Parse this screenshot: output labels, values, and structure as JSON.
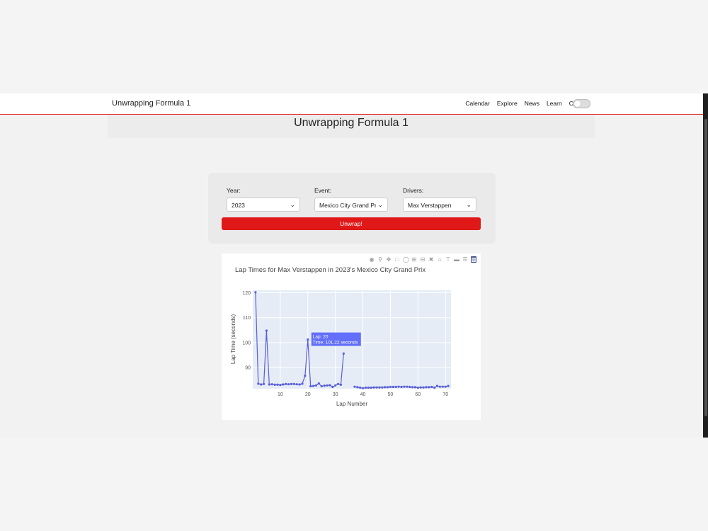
{
  "nav": {
    "brand": "Unwrapping Formula 1",
    "links": [
      "Calendar",
      "Explore",
      "News",
      "Learn",
      "Contact"
    ]
  },
  "page_title": "Unwrapping Formula 1",
  "form": {
    "year": {
      "label": "Year:",
      "value": "2023"
    },
    "event": {
      "label": "Event:",
      "value": "Mexico City Grand Prix"
    },
    "drivers": {
      "label": "Drivers:",
      "value": "Max Verstappen"
    },
    "button_label": "Unwrap!"
  },
  "modebar_icons": [
    "camera-icon",
    "zoom-icon",
    "pan-icon",
    "box-select-icon",
    "lasso-icon",
    "zoom-in-icon",
    "zoom-out-icon",
    "autoscale-icon",
    "reset-axes-icon",
    "spike-lines-icon",
    "hover-closest-icon",
    "hover-compare-icon",
    "plotly-logo-icon"
  ],
  "chart_data": {
    "type": "line",
    "title": "Lap Times for Max Verstappen in 2023's Mexico City Grand Prix",
    "xlabel": "Lap Number",
    "ylabel": "Lap Time (seconds)",
    "xlim": [
      0,
      72
    ],
    "ylim": [
      81.5,
      121
    ],
    "xticks": [
      10,
      20,
      30,
      40,
      50,
      60,
      70
    ],
    "yticks": [
      90,
      100,
      110,
      120
    ],
    "grid": true,
    "colors": {
      "line": "#5a5fd6",
      "plot_bg": "#e5ecf6",
      "tooltip": "#636efa"
    },
    "series": [
      {
        "x": [
          1,
          2,
          3,
          4,
          5,
          6,
          7,
          8,
          9,
          10,
          11,
          12,
          13,
          14,
          15,
          16,
          17,
          18,
          19,
          20,
          21,
          22,
          23,
          24,
          25,
          26,
          27,
          28,
          29,
          30,
          31,
          32,
          33
        ],
        "y": [
          120.2,
          83.5,
          83.2,
          83.4,
          104.8,
          83.2,
          83.3,
          83.1,
          83.1,
          83.0,
          83.2,
          83.4,
          83.3,
          83.4,
          83.4,
          83.3,
          83.2,
          83.5,
          86.7,
          101.22,
          82.5,
          82.6,
          82.8,
          83.6,
          82.5,
          82.7,
          82.8,
          82.9,
          82.2,
          82.8,
          83.4,
          83.1,
          95.6
        ]
      },
      {
        "x": [
          37,
          38,
          39,
          40,
          41,
          42,
          43,
          44,
          45,
          46,
          47,
          48,
          49,
          50,
          51,
          52,
          53,
          54,
          55,
          56,
          57,
          58,
          59,
          60,
          61,
          62,
          63,
          64,
          65,
          66,
          67,
          68,
          69,
          70,
          71
        ],
        "y": [
          82.3,
          82.1,
          81.9,
          81.7,
          81.9,
          81.9,
          81.9,
          82.0,
          82.0,
          82.0,
          82.0,
          82.1,
          82.1,
          82.2,
          82.2,
          82.2,
          82.3,
          82.2,
          82.3,
          82.3,
          82.2,
          82.1,
          82.1,
          81.9,
          82.0,
          82.0,
          82.1,
          82.1,
          82.2,
          81.9,
          82.6,
          82.3,
          82.3,
          82.3,
          82.6
        ]
      }
    ],
    "tooltip": {
      "lap_text": "Lap: 20",
      "time_text": "Time: 101.22 seconds",
      "x": 20,
      "y": 101.22
    }
  }
}
